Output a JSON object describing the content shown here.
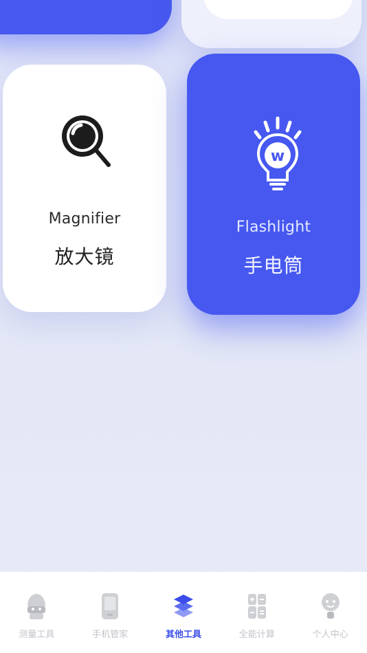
{
  "tools": [
    {
      "id": "magnifier",
      "label_en": "Magnifier",
      "label_cn": "放大镜",
      "icon": "magnifier-icon"
    },
    {
      "id": "flashlight",
      "label_en": "Flashlight",
      "label_cn": "手电筒",
      "icon": "flashlight-icon"
    }
  ],
  "nav": {
    "active_index": 2,
    "items": [
      {
        "label": "测量工具",
        "icon": "ruler-icon"
      },
      {
        "label": "手机管家",
        "icon": "phone-icon"
      },
      {
        "label": "其他工具",
        "icon": "layers-icon"
      },
      {
        "label": "全能计算",
        "icon": "calculator-icon"
      },
      {
        "label": "个人中心",
        "icon": "user-icon"
      }
    ]
  },
  "colors": {
    "accent": "#4658f0",
    "nav_active": "#3b4de8",
    "nav_inactive": "#c2c4ca",
    "card_white": "#ffffff"
  }
}
